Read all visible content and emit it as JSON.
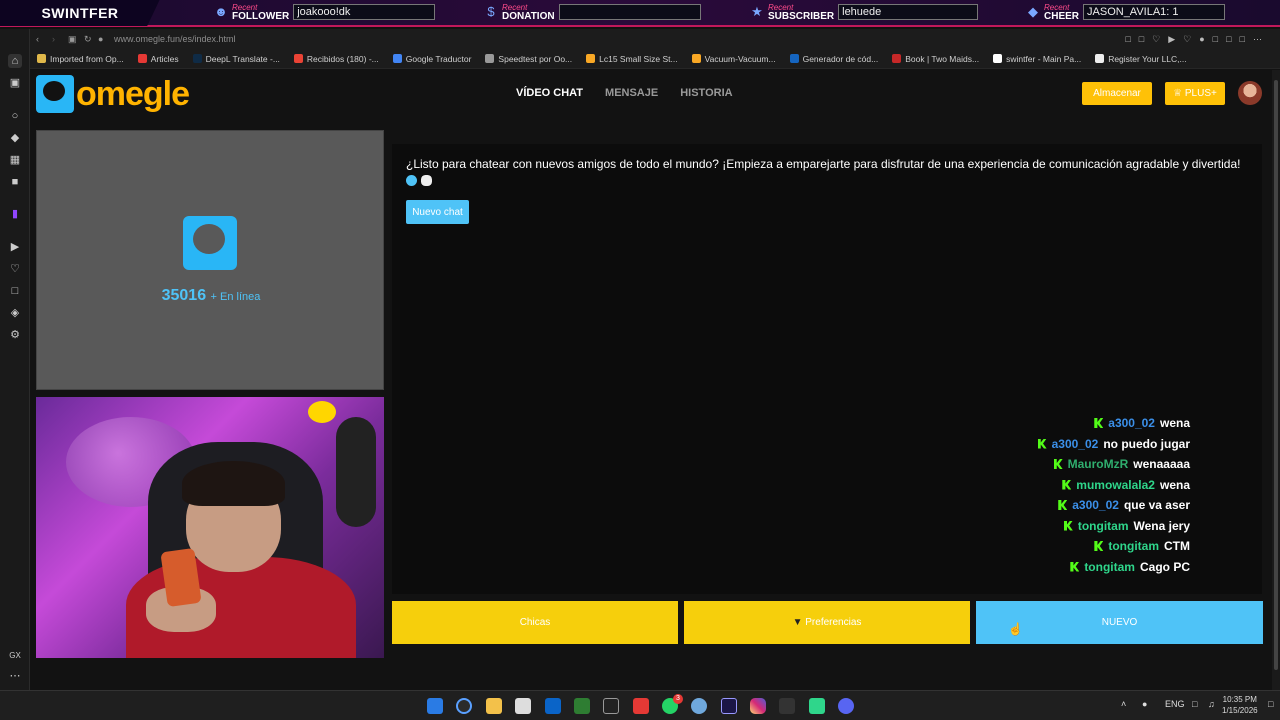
{
  "overlay": {
    "brand": "SWINTFER",
    "follower": {
      "recent": "Recent",
      "kind": "FOLLOWER",
      "value": "joakooo!dk"
    },
    "donation": {
      "recent": "Recent",
      "kind": "DONATION",
      "value": ""
    },
    "subscriber": {
      "recent": "Recent",
      "kind": "SUBSCRIBER",
      "value": "lehuede"
    },
    "cheer": {
      "recent": "Recent",
      "kind": "CHEER",
      "value": "JASON_AVILA1: 1"
    }
  },
  "browser": {
    "url": "www.omegle.fun/es/index.html",
    "bookmarks": [
      {
        "label": "Imported from Op...",
        "color": "#e0b84a"
      },
      {
        "label": "Articles",
        "color": "#e53935"
      },
      {
        "label": "DeepL Translate -...",
        "color": "#0f2b46"
      },
      {
        "label": "Recibidos (180) -...",
        "color": "#ea4335"
      },
      {
        "label": "Google Traductor",
        "color": "#4285f4"
      },
      {
        "label": "Speedtest por Oo...",
        "color": "#999999"
      },
      {
        "label": "Lc15 Small Size St...",
        "color": "#f9a825"
      },
      {
        "label": "Vacuum-Vacuum...",
        "color": "#f9a825"
      },
      {
        "label": "Generador de cód...",
        "color": "#1565c0"
      },
      {
        "label": "Book | Two Maids...",
        "color": "#c62828"
      },
      {
        "label": "swintfer - Main Pa...",
        "color": "#ffffff"
      },
      {
        "label": "Register Your LLC,...",
        "color": "#eeeeee"
      }
    ]
  },
  "site": {
    "logo_text": "omegle",
    "nav": {
      "video": "VÍDEO CHAT",
      "message": "MENSAJE",
      "history": "HISTORIA"
    },
    "store_label": "Almacenar",
    "plus_label": "PLUS+",
    "online_count": "35016",
    "online_label": "+ En línea",
    "intro_text": "¿Listo para chatear con nuevos amigos de todo el mundo? ¡Empieza a emparejarte para disfrutar de una experiencia de comunicación agradable y divertida!",
    "new_chat_label": "Nuevo chat",
    "buttons": {
      "girls": "Chicas",
      "preferences": "Preferencias",
      "new": "NUEVO"
    }
  },
  "twitch_chat": [
    {
      "user": "a300_02",
      "user_color": "#3b8fe8",
      "message": "wena"
    },
    {
      "user": "a300_02",
      "user_color": "#3b8fe8",
      "message": "no puedo jugar"
    },
    {
      "user": "MauroMzR",
      "user_color": "#2fae6e",
      "message": "wenaaaaa"
    },
    {
      "user": "mumowalala2",
      "user_color": "#2fd68b",
      "message": "wena"
    },
    {
      "user": "a300_02",
      "user_color": "#3b8fe8",
      "message": "que va aser"
    },
    {
      "user": "tongitam",
      "user_color": "#2fd68b",
      "message": "Wena jery"
    },
    {
      "user": "tongitam",
      "user_color": "#2fd68b",
      "message": "CTM"
    },
    {
      "user": "tongitam",
      "user_color": "#2fd68b",
      "message": "Cago PC"
    }
  ],
  "taskbar": {
    "language": "ENG",
    "time": "10:35 PM",
    "date": "1/15/2026",
    "whatsapp_badge": "3"
  },
  "colors": {
    "accent_yellow": "#f6cf0c",
    "accent_blue": "#4fc3f7"
  }
}
